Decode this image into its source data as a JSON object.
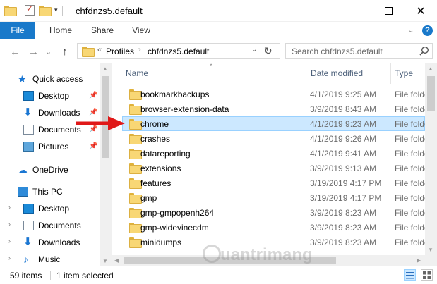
{
  "window": {
    "title": "chfdnzs5.default",
    "qat_dropdown": "▾",
    "minimize": "",
    "maximize": "",
    "close": "✕"
  },
  "ribbon": {
    "tabs": [
      "File",
      "Home",
      "Share",
      "View"
    ],
    "expand_chevron": "⌄",
    "help": "?"
  },
  "address": {
    "back": "←",
    "forward": "→",
    "recent": "⌄",
    "up": "↑",
    "overflow": "«",
    "crumbs": [
      "Profiles",
      "chfdnzs5.default"
    ],
    "separator": "›",
    "dropdown": "⌄",
    "refresh": "↻"
  },
  "search": {
    "placeholder": "Search chfdnzs5.default"
  },
  "nav": {
    "items": [
      {
        "label": "Quick access",
        "icon": "star-icon",
        "pinned": false
      },
      {
        "label": "Desktop",
        "icon": "desktop-icon",
        "pinned": true
      },
      {
        "label": "Downloads",
        "icon": "download-icon",
        "pinned": true
      },
      {
        "label": "Documents",
        "icon": "documents-icon",
        "pinned": true
      },
      {
        "label": "Pictures",
        "icon": "pictures-icon",
        "pinned": true
      },
      {
        "label": "OneDrive",
        "icon": "cloud-icon",
        "pinned": false
      },
      {
        "label": "This PC",
        "icon": "computer-icon",
        "pinned": false
      },
      {
        "label": "Desktop",
        "icon": "desktop-icon",
        "pinned": false
      },
      {
        "label": "Documents",
        "icon": "documents-icon",
        "pinned": false
      },
      {
        "label": "Downloads",
        "icon": "download-icon",
        "pinned": false
      },
      {
        "label": "Music",
        "icon": "music-icon",
        "pinned": false
      }
    ],
    "pin_glyph": "📌",
    "expand_glyph": "›"
  },
  "list": {
    "columns": {
      "name": "Name",
      "date": "Date modified",
      "type": "Type"
    },
    "rows": [
      {
        "name": "bookmarkbackups",
        "date": "4/1/2019 9:25 AM",
        "type": "File folder",
        "selected": false
      },
      {
        "name": "browser-extension-data",
        "date": "3/9/2019 8:43 AM",
        "type": "File folder",
        "selected": false
      },
      {
        "name": "chrome",
        "date": "4/1/2019 9:23 AM",
        "type": "File folder",
        "selected": true
      },
      {
        "name": "crashes",
        "date": "4/1/2019 9:26 AM",
        "type": "File folder",
        "selected": false
      },
      {
        "name": "datareporting",
        "date": "4/1/2019 9:41 AM",
        "type": "File folder",
        "selected": false
      },
      {
        "name": "extensions",
        "date": "3/9/2019 9:13 AM",
        "type": "File folder",
        "selected": false
      },
      {
        "name": "features",
        "date": "3/19/2019 4:17 PM",
        "type": "File folder",
        "selected": false
      },
      {
        "name": "gmp",
        "date": "3/19/2019 4:17 PM",
        "type": "File folder",
        "selected": false
      },
      {
        "name": "gmp-gmpopenh264",
        "date": "3/9/2019 8:23 AM",
        "type": "File folder",
        "selected": false
      },
      {
        "name": "gmp-widevinecdm",
        "date": "3/9/2019 8:23 AM",
        "type": "File folder",
        "selected": false
      },
      {
        "name": "minidumps",
        "date": "3/9/2019 8:23 AM",
        "type": "File folder",
        "selected": false
      }
    ]
  },
  "status": {
    "item_count": "59 items",
    "selected": "1 item selected"
  },
  "watermark": "uantrimang",
  "colors": {
    "accent": "#1979ca",
    "selection_bg": "#cce8ff",
    "selection_border": "#99d1ff",
    "annotation_arrow": "#e01818",
    "folder": "#f8d775"
  }
}
